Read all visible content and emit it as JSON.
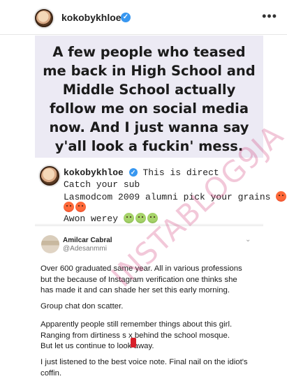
{
  "post": {
    "username": "kokobykhloe",
    "verified_glyph": "✓",
    "more_glyph": "•••",
    "quote_lines": [
      "A few people who teased",
      "me back in High School and",
      "Middle School actually",
      "follow me on social media",
      "now. And I just wanna say",
      "y'all look a fuckin' mess."
    ]
  },
  "caption": {
    "username": "kokobykhloe",
    "verified_glyph": "✓",
    "line1_text": "This is direct",
    "line2": "Catch your sub",
    "line3": "Lasmodcom 2009 alumni pick your grains",
    "line4": "Awon werey",
    "emoji_names": [
      "angry-face",
      "angry-face",
      "angry-face",
      "nauseated-face",
      "nauseated-face",
      "nauseated-face"
    ]
  },
  "tweet": {
    "name": "Amilcar Cabral",
    "handle": "@Adesanmmi",
    "chevron": "⌄",
    "paragraph1": [
      "Over 600 graduated same year. All in various professions",
      "but the because of Instagram verification one thinks she",
      "has made it and can shade her set this early morning."
    ],
    "paragraph2": "Group chat don scatter.",
    "paragraph3": [
      "Apparently people still remember things about this girl.",
      "Ranging from dirtiness s x behind the school mosque.",
      "But let us continue to look away."
    ],
    "paragraph4": [
      "I just listened to the best voice note. Final nail on the idiot's",
      "coffin."
    ]
  },
  "watermark": "INSTABLOG9JA",
  "colors": {
    "verified": "#3897f0",
    "quote_background": "#eceaf4",
    "watermark": "#cf3878"
  }
}
